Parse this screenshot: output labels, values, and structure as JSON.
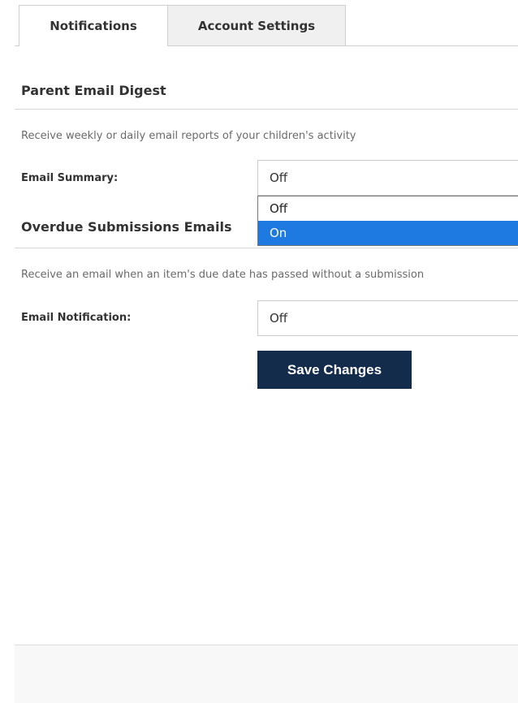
{
  "tabs": {
    "notifications": "Notifications",
    "account_settings": "Account Settings"
  },
  "digest": {
    "title": "Parent Email Digest",
    "description": "Receive weekly or daily email reports of your children's activity",
    "field_label": "Email Summary:",
    "value": "Off",
    "options": [
      "Off",
      "On"
    ],
    "highlighted_option": "On"
  },
  "overdue": {
    "title": "Overdue Submissions Emails",
    "description": "Receive an email when an item's due date has passed without a submission",
    "field_label": "Email Notification:",
    "value": "Off"
  },
  "actions": {
    "save_label": "Save Changes"
  },
  "colors": {
    "button_bg": "#132c4c",
    "option_highlight": "#1e7ae0",
    "tab_inactive_bg": "#f0f0f0"
  }
}
